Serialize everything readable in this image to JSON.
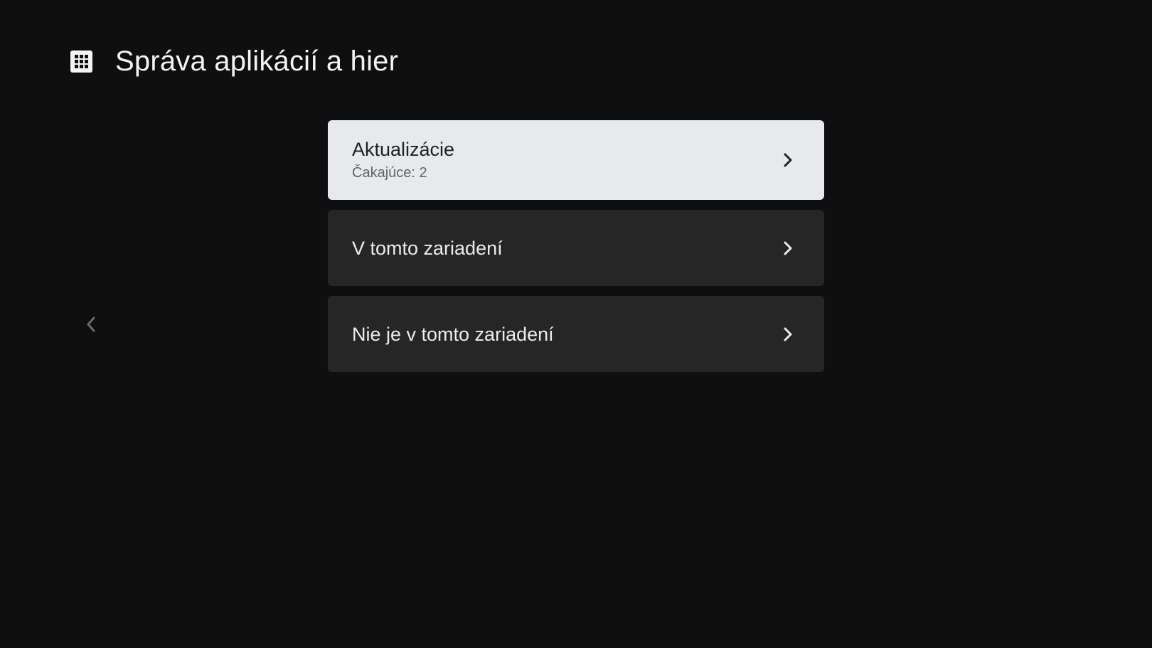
{
  "header": {
    "icon": "apps-grid-icon",
    "title": "Správa aplikácií a hier"
  },
  "nav": {
    "back_icon": "chevron-left-icon"
  },
  "menu": {
    "items": [
      {
        "title": "Aktualizácie",
        "subtitle": "Čakajúce: 2",
        "focused": true,
        "icon": "chevron-right-icon"
      },
      {
        "title": "V tomto zariadení",
        "focused": false,
        "icon": "chevron-right-icon"
      },
      {
        "title": "Nie je v tomto zariadení",
        "focused": false,
        "icon": "chevron-right-icon"
      }
    ]
  },
  "colors": {
    "background": "#0f0f0f",
    "item_background": "#262626",
    "focused_background": "#e8e9ec",
    "focused_text": "#202124",
    "text": "#ececec"
  }
}
